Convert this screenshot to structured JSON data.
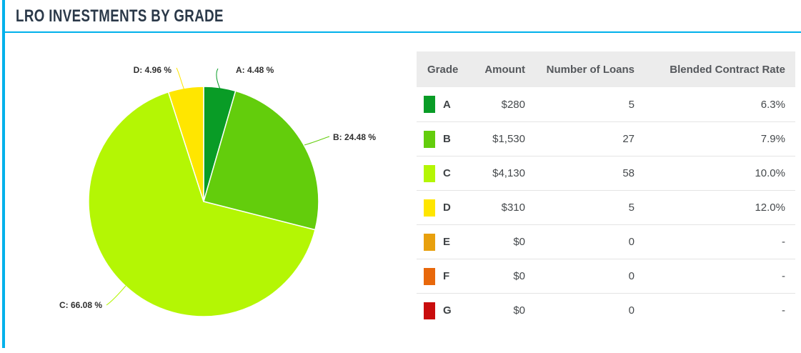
{
  "header": {
    "title": "LRO INVESTMENTS BY GRADE"
  },
  "colors": {
    "accent": "#00b1eb",
    "title_text": "#2b3949",
    "table_header_bg": "#ececec",
    "table_header_text": "#55585c",
    "table_cell_text": "#45494c",
    "row_divider": "#e4e4e4"
  },
  "chart_data": {
    "type": "pie",
    "title": "LRO Investments by Grade",
    "legend_position": "none",
    "slices": [
      {
        "label": "A",
        "percent": 4.48,
        "callout": "A: 4.48 %",
        "color": "#099c26"
      },
      {
        "label": "B",
        "percent": 24.48,
        "callout": "B: 24.48 %",
        "color": "#63cd0c"
      },
      {
        "label": "C",
        "percent": 66.08,
        "callout": "C: 66.08 %",
        "color": "#b4f604"
      },
      {
        "label": "D",
        "percent": 4.96,
        "callout": "D: 4.96 %",
        "color": "#ffe600"
      }
    ]
  },
  "table": {
    "columns": [
      "Grade",
      "Amount",
      "Number of Loans",
      "Blended Contract Rate"
    ],
    "rows": [
      {
        "grade": "A",
        "color": "#099c26",
        "amount": "$280",
        "loans": "5",
        "rate": "6.3%"
      },
      {
        "grade": "B",
        "color": "#63cd0c",
        "amount": "$1,530",
        "loans": "27",
        "rate": "7.9%"
      },
      {
        "grade": "C",
        "color": "#b4f604",
        "amount": "$4,130",
        "loans": "58",
        "rate": "10.0%"
      },
      {
        "grade": "D",
        "color": "#ffe600",
        "amount": "$310",
        "loans": "5",
        "rate": "12.0%"
      },
      {
        "grade": "E",
        "color": "#e8a00d",
        "amount": "$0",
        "loans": "0",
        "rate": "-"
      },
      {
        "grade": "F",
        "color": "#e8680b",
        "amount": "$0",
        "loans": "0",
        "rate": "-"
      },
      {
        "grade": "G",
        "color": "#c90d0d",
        "amount": "$0",
        "loans": "0",
        "rate": "-"
      }
    ]
  }
}
